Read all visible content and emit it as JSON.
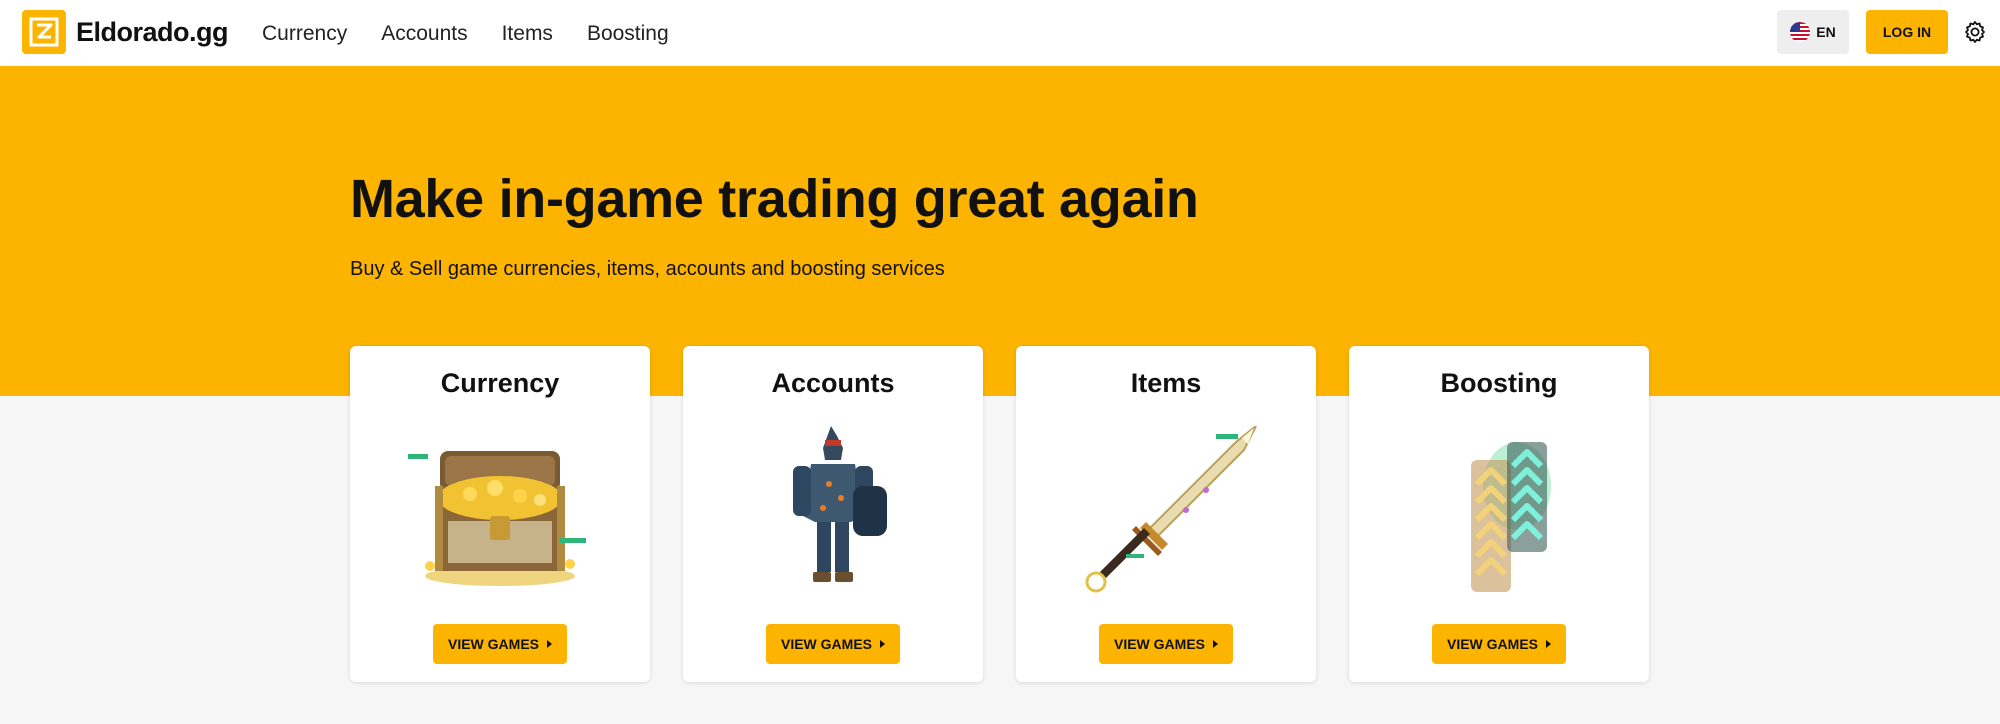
{
  "brand": {
    "name": "Eldorado.gg",
    "color": "#fcb400"
  },
  "nav": {
    "items": [
      {
        "label": "Currency"
      },
      {
        "label": "Accounts"
      },
      {
        "label": "Items"
      },
      {
        "label": "Boosting"
      }
    ]
  },
  "header": {
    "language": "EN",
    "login_label": "LOG IN",
    "settings_icon": "gear-icon",
    "flag_icon": "us-flag-icon"
  },
  "hero": {
    "title": "Make in-game trading great again",
    "subtitle": "Buy & Sell game currencies, items, accounts and boosting services"
  },
  "cards": [
    {
      "title": "Currency",
      "button": "VIEW GAMES",
      "art": "treasure-chest-illustration"
    },
    {
      "title": "Accounts",
      "button": "VIEW GAMES",
      "art": "armored-knight-illustration"
    },
    {
      "title": "Items",
      "button": "VIEW GAMES",
      "art": "sword-illustration"
    },
    {
      "title": "Boosting",
      "button": "VIEW GAMES",
      "art": "rank-chevrons-illustration"
    }
  ]
}
